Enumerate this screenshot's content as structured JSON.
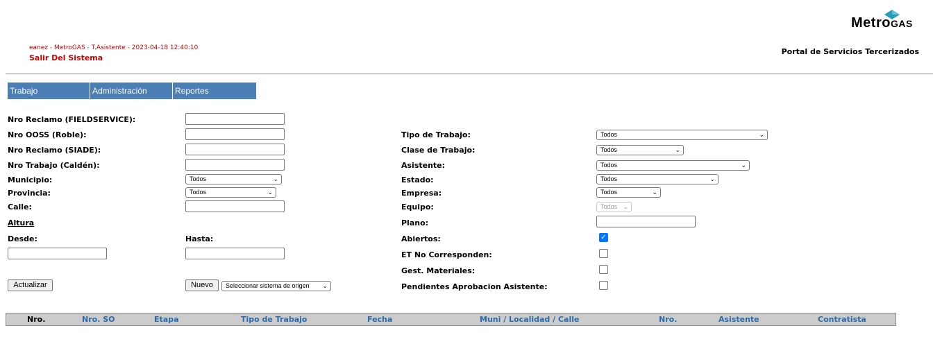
{
  "brand": {
    "name_prefix": "Metro",
    "name_suffix": "GAS",
    "portal_title": "Portal de Servicios Tercerizados"
  },
  "session": {
    "info": "eanez - MetroGAS - T.Asistente - 2023-04-18 12:40:10",
    "logout_label": "Salir Del Sistema"
  },
  "menu": [
    {
      "label": "Trabajo"
    },
    {
      "label": "Administración"
    },
    {
      "label": "Reportes"
    }
  ],
  "filters_left": {
    "nro_reclamo_fs": {
      "label": "Nro Reclamo (FIELDSERVICE):",
      "value": ""
    },
    "nro_ooss": {
      "label": "Nro OOSS (Roble):",
      "value": ""
    },
    "nro_reclamo_siade": {
      "label": "Nro Reclamo (SIADE):",
      "value": ""
    },
    "nro_trabajo": {
      "label": "Nro Trabajo (Caldén):",
      "value": ""
    },
    "municipio": {
      "label": "Municipio:",
      "selected": "Todos"
    },
    "provincia": {
      "label": "Provincia:",
      "selected": "Todos"
    },
    "calle": {
      "label": "Calle:",
      "value": ""
    },
    "altura_label": "Altura",
    "desde": {
      "label": "Desde:",
      "value": ""
    },
    "hasta": {
      "label": "Hasta:",
      "value": ""
    }
  },
  "filters_right": {
    "tipo_trabajo": {
      "label": "Tipo de Trabajo:",
      "selected": "Todos"
    },
    "clase_trabajo": {
      "label": "Clase de Trabajo:",
      "selected": "Todos"
    },
    "asistente": {
      "label": "Asistente:",
      "selected": "Todos"
    },
    "estado": {
      "label": "Estado:",
      "selected": "Todos"
    },
    "empresa": {
      "label": "Empresa:",
      "selected": "Todos"
    },
    "equipo": {
      "label": "Equipo:",
      "selected": "Todos"
    },
    "plano": {
      "label": "Plano:",
      "value": ""
    },
    "abiertos": {
      "label": "Abiertos:",
      "checked": true
    },
    "et_no_corresponden": {
      "label": "ET No Corresponden:",
      "checked": false
    },
    "gest_materiales": {
      "label": "Gest. Materiales:",
      "checked": false
    },
    "pendientes_aprobacion": {
      "label": "Pendientes Aprobacion Asistente:",
      "checked": false
    }
  },
  "actions": {
    "actualizar": "Actualizar",
    "nuevo": "Nuevo",
    "sistema_origen": "Seleccionar sistema de origen"
  },
  "table": {
    "columns": [
      "Nro.",
      "Nro. SO",
      "Etapa",
      "Tipo de Trabajo",
      "Fecha",
      "Muni / Localidad / Calle",
      "Nro.",
      "Asistente",
      "Contratista"
    ],
    "rows": []
  },
  "colors": {
    "menu_bg": "#4a7eb5",
    "session_red": "#cc0000",
    "header_link": "#2a6aa8",
    "table_header_bg": "#cccccc",
    "logo_accent": "#2a9bb5"
  }
}
